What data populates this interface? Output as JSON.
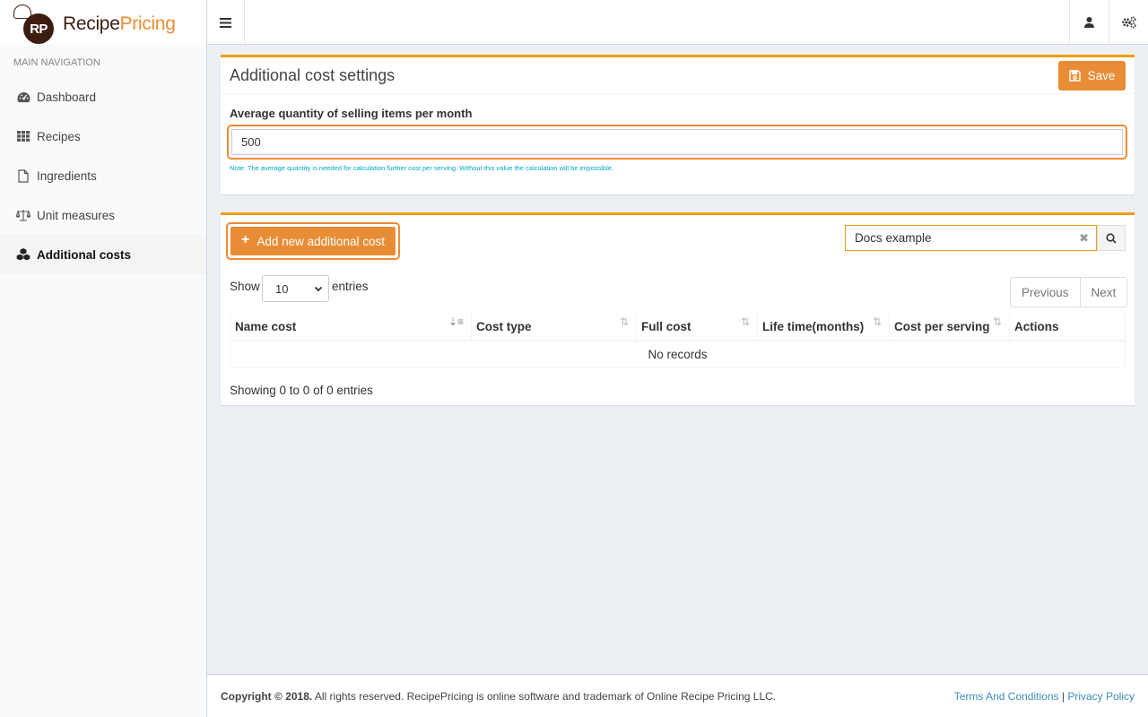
{
  "brand": {
    "initials": "RP",
    "name_part1": "Recipe",
    "name_part2": "Pricing",
    "accent_color": "#e88d35"
  },
  "sidebar": {
    "header": "MAIN NAVIGATION",
    "items": [
      {
        "label": "Dashboard",
        "icon": "dashboard-icon"
      },
      {
        "label": "Recipes",
        "icon": "grid-icon"
      },
      {
        "label": "Ingredients",
        "icon": "file-icon"
      },
      {
        "label": "Unit measures",
        "icon": "balance-scale-icon"
      },
      {
        "label": "Additional costs",
        "icon": "cubes-icon",
        "active": true
      }
    ]
  },
  "settings": {
    "title": "Additional cost settings",
    "save_label": "Save",
    "field_label": "Average quantity of selling items per month",
    "field_value": "500",
    "note": "Note: The average quantity is needed for calculation further cost per serving. Without this value the calculation will be impossible."
  },
  "costs": {
    "add_label": "Add new additional cost",
    "search_value": "Docs example",
    "show_label": "Show",
    "page_size": "10",
    "entries_label": "entries",
    "prev_label": "Previous",
    "next_label": "Next",
    "columns": [
      "Name cost",
      "Cost type",
      "Full cost",
      "Life time(months)",
      "Cost per serving",
      "Actions"
    ],
    "empty_text": "No records",
    "info": "Showing 0 to 0 of 0 entries"
  },
  "footer": {
    "copyright_bold": "Copyright © 2018.",
    "copyright_rest": " All rights reserved. RecipePricing is online software and trademark of Online Recipe Pricing LLC.",
    "terms": "Terms And Conditions",
    "separator": "|",
    "privacy": "Privacy Policy"
  }
}
